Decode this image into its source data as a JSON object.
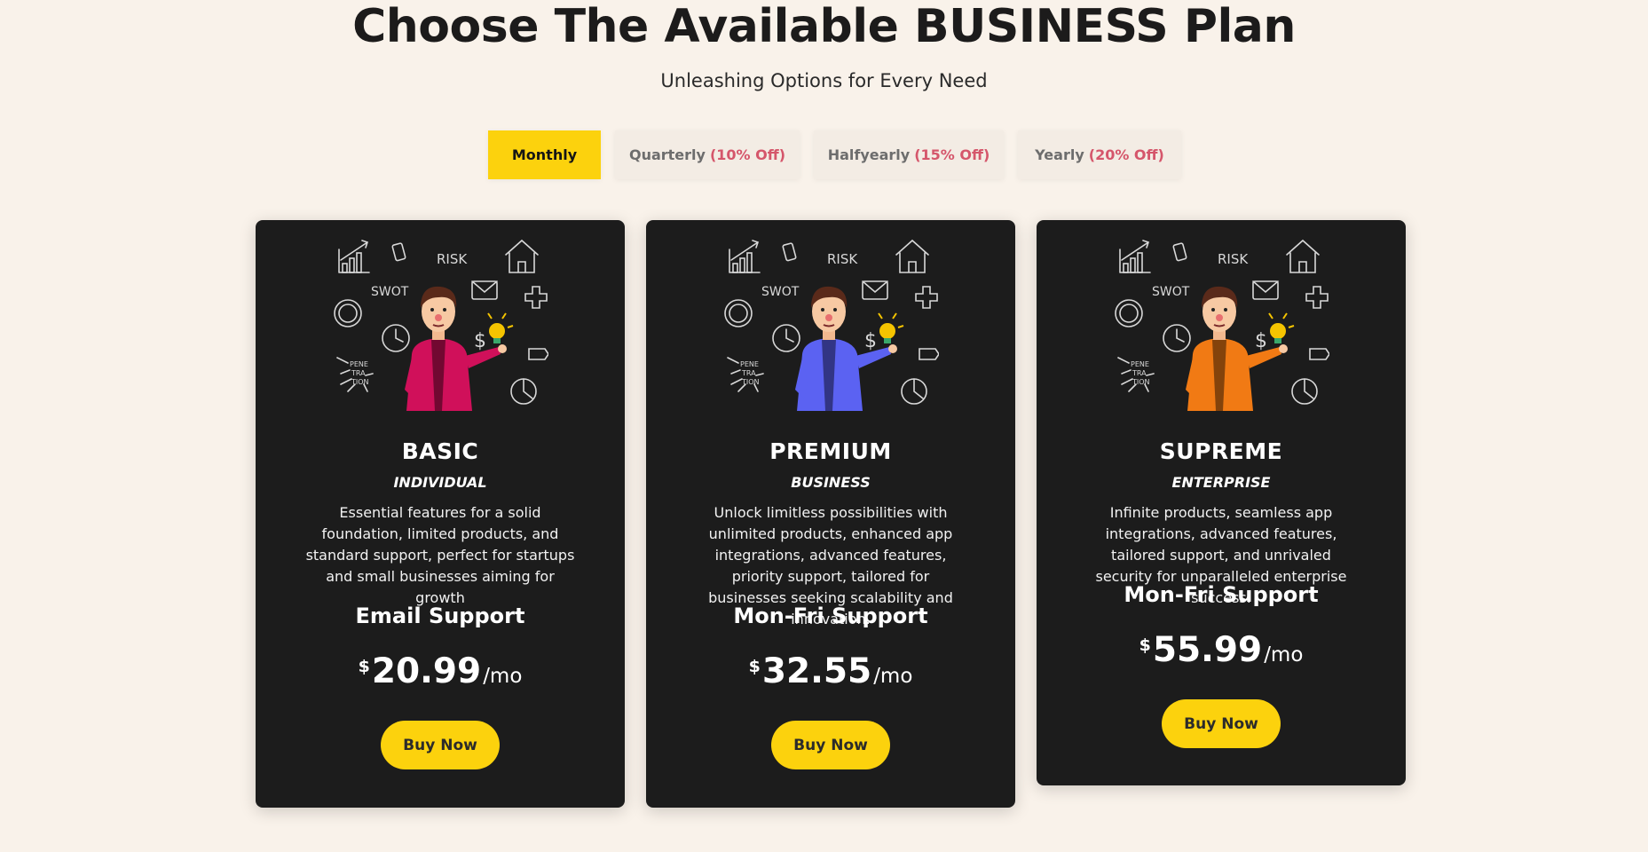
{
  "header": {
    "title": "Choose The Available BUSINESS Plan",
    "subtitle": "Unleashing Options for Every Need"
  },
  "tabs": [
    {
      "label": "Monthly",
      "discount": "",
      "active": true
    },
    {
      "label": "Quarterly",
      "discount": "(10% Off)",
      "active": false
    },
    {
      "label": "Halfyearly",
      "discount": "(15% Off)",
      "active": false
    },
    {
      "label": "Yearly",
      "discount": "(20% Off)",
      "active": false
    }
  ],
  "plans": [
    {
      "name": "BASIC",
      "tag": "INDIVIDUAL",
      "description": "Essential features for a solid foundation, limited products, and standard support, perfect for startups and small businesses aiming for growth",
      "support": "Email Support",
      "currency": "$",
      "price": "20.99",
      "period": "/mo",
      "button": "Buy Now",
      "shirt_color": "#d0105a"
    },
    {
      "name": "PREMIUM",
      "tag": "BUSINESS",
      "description": "Unlock limitless possibilities with unlimited products, enhanced app integrations, advanced features, priority support, tailored for businesses seeking scalability and innovation.",
      "support": "Mon-Fri Support",
      "currency": "$",
      "price": "32.55",
      "period": "/mo",
      "button": "Buy Now",
      "shirt_color": "#5b62f2"
    },
    {
      "name": "SUPREME",
      "tag": "ENTERPRISE",
      "description": "Infinite products, seamless app integrations, advanced features, tailored support, and unrivaled security for unparalleled enterprise success.",
      "support": "Mon-Fri Support",
      "currency": "$",
      "price": "55.99",
      "period": "/mo",
      "button": "Buy Now",
      "shirt_color": "#f17a14"
    }
  ],
  "illustration_text": {
    "risk": "RISK",
    "swot": "SWOT",
    "penetration": [
      "PENE",
      "TRA",
      "TION"
    ],
    "dollar": "$"
  },
  "colors": {
    "accent": "#fcd20d",
    "card_bg": "#1c1c1c",
    "page_bg": "#f9f2ea",
    "discount": "#d5566b"
  }
}
